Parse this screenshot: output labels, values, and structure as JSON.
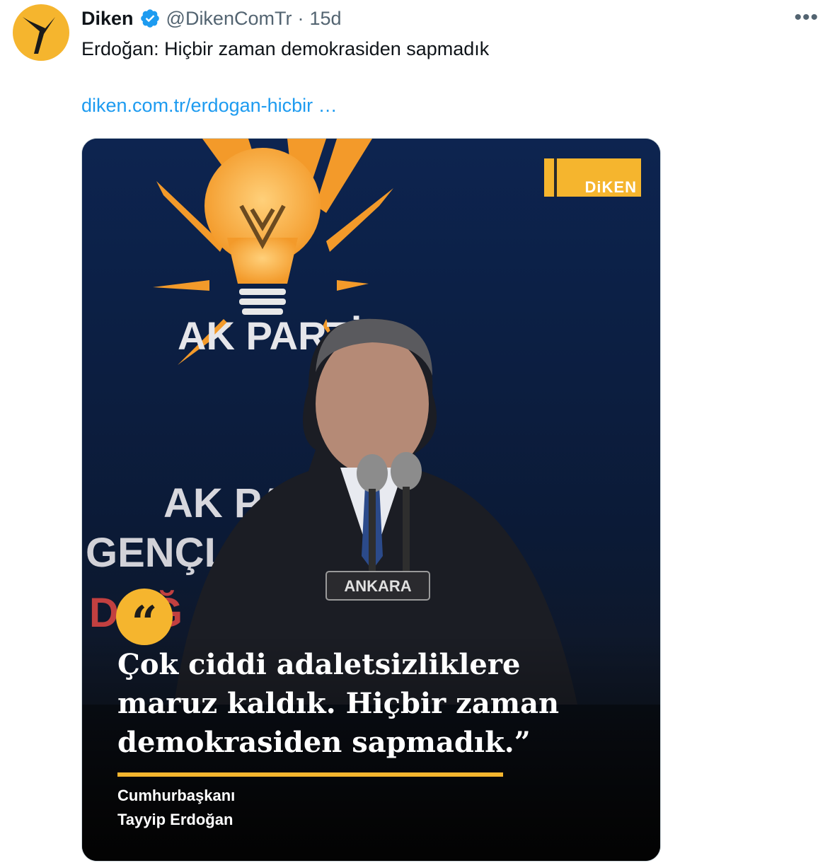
{
  "tweet": {
    "author_name": "Diken",
    "handle": "@DikenComTr",
    "separator": "·",
    "time": "15d",
    "more_icon": "more-horizontal-icon",
    "verified_icon": "verified-badge-icon",
    "text": "Erdoğan: Hiçbir zaman demokrasiden sapmadık",
    "link": "diken.com.tr/erdogan-hicbir …"
  },
  "media": {
    "backdrop_text_1": "AK PARTİ",
    "backdrop_text_2": "AK PAR",
    "backdrop_text_3": "GENÇLİ",
    "backdrop_text_4": "DOĞ",
    "lectern_sign": "ANKARA",
    "logo_text": "DiKEN",
    "quote": "Çok ciddi adaletsizliklere maruz kaldık. Hiçbir zaman demokrasiden sapmadık.”",
    "quote_mark": "“",
    "attribution_line1": "Cumhurbaşkanı",
    "attribution_line2": "Tayyip Erdoğan",
    "accent_color": "#f5b52e"
  }
}
